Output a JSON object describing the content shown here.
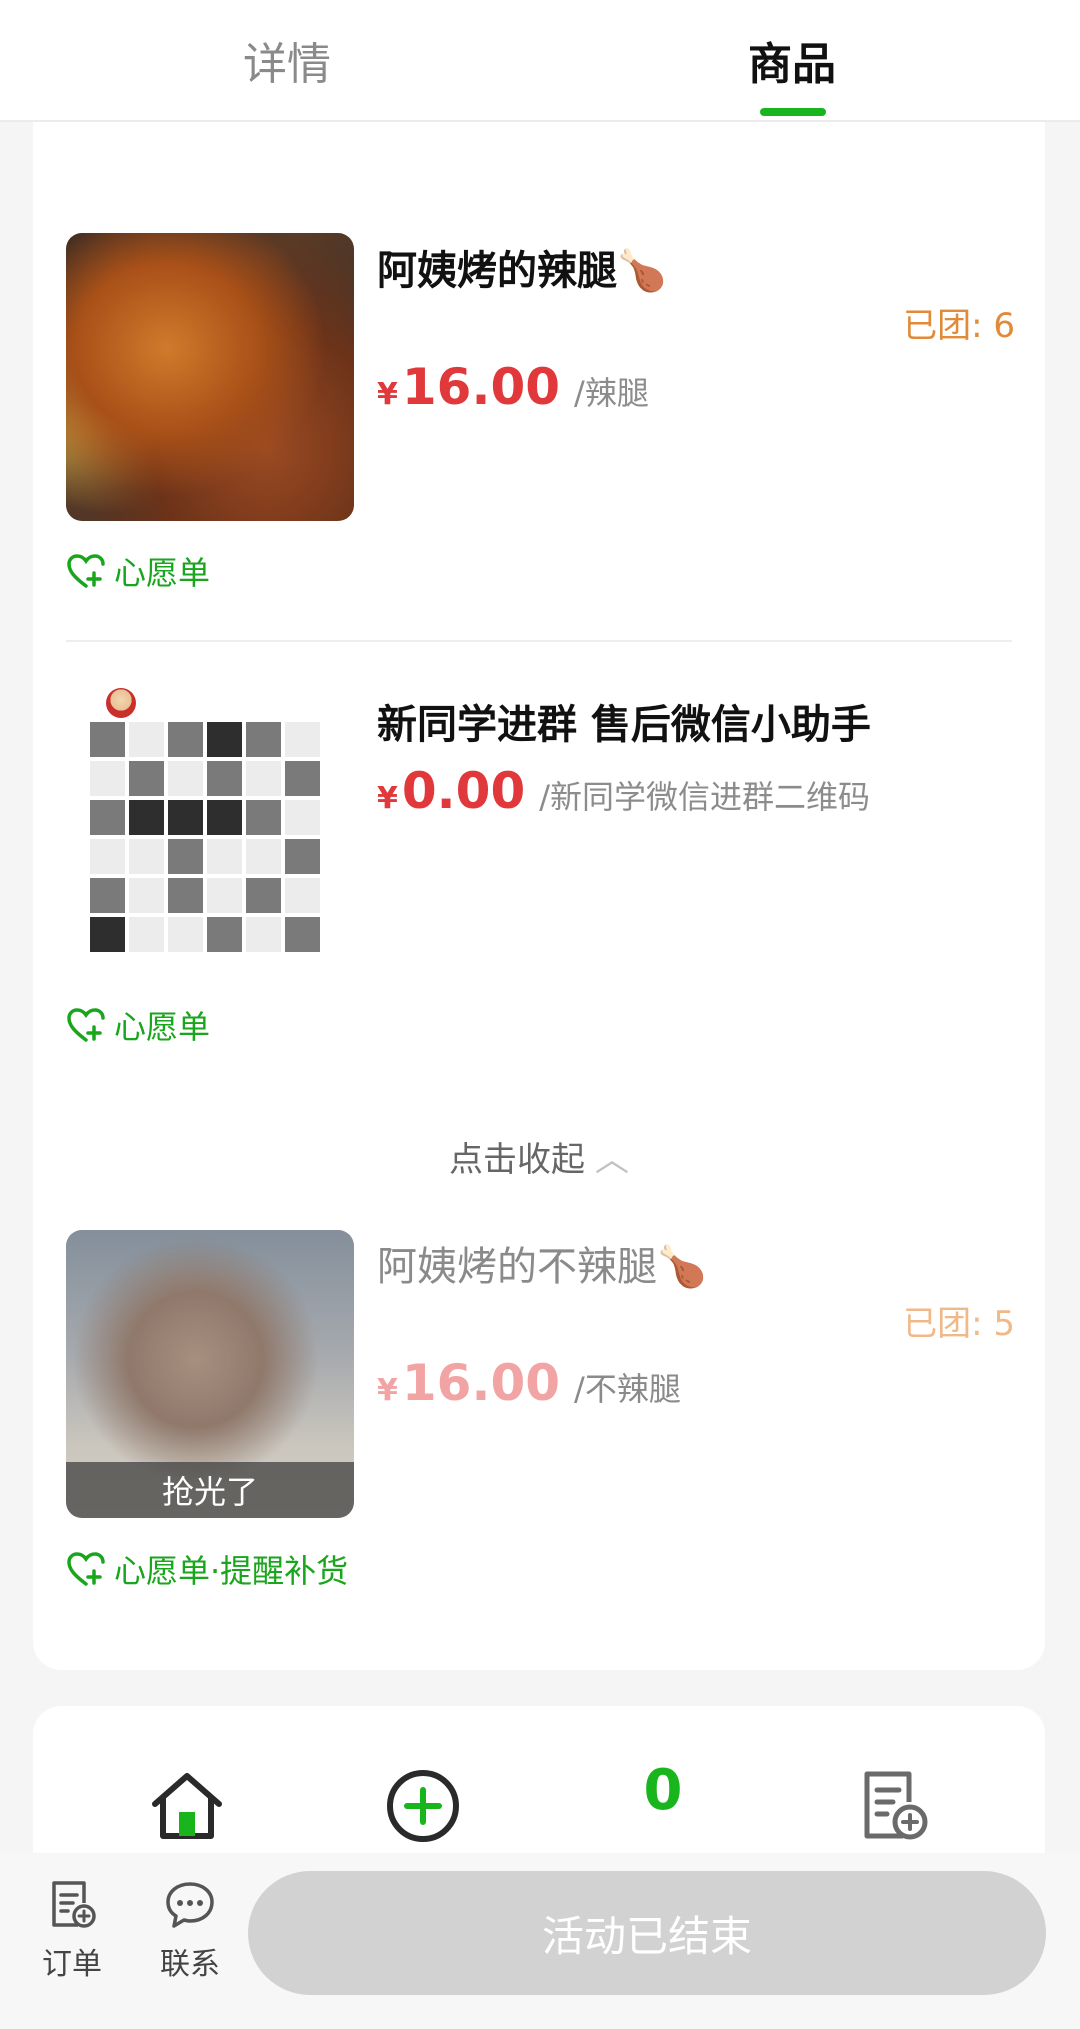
{
  "tabs": [
    {
      "label": "详情"
    },
    {
      "label": "商品"
    }
  ],
  "products": [
    {
      "name": "阿姨烤的辣腿",
      "emoji": "🍗",
      "sold": "已团: 6",
      "currency": "¥",
      "price": "16.00",
      "unit": "/辣腿",
      "wish": "心愿单"
    },
    {
      "name": "新同学进群 售后微信小助手",
      "currency": "¥",
      "price": "0.00",
      "unit": "/新同学微信进群二维码",
      "wish": "心愿单"
    },
    {
      "name": "阿姨烤的不辣腿",
      "emoji": "🍗",
      "sold": "已团: 5",
      "currency": "¥",
      "price": "16.00",
      "unit": "/不辣腿",
      "wish": "心愿单·提醒补货",
      "soldout": "抢光了"
    }
  ],
  "collapse_label": "点击收起",
  "nav": {
    "home_icon": "home-icon",
    "add_icon": "plus-circle-icon",
    "cart_count": "0",
    "order_icon": "order-add-icon"
  },
  "bottom_bar": {
    "orders_label": "订单",
    "contact_label": "联系",
    "end_label": "活动已结束"
  },
  "colors": {
    "accent": "#19b51d",
    "price": "#e0383b",
    "sold": "#e08a3a"
  }
}
